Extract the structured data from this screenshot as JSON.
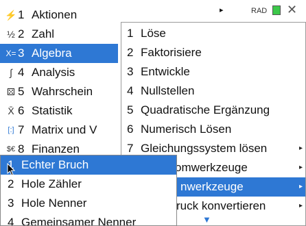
{
  "statusbar": {
    "mode": "RAD",
    "arrow": "▸",
    "battery_color": "#3cc84a"
  },
  "menu1": {
    "items": [
      {
        "num": "1",
        "label": "Aktionen",
        "icon": "lightning-icon",
        "glyph": "⚡"
      },
      {
        "num": "2",
        "label": "Zahl",
        "icon": "fraction-icon",
        "glyph": "½"
      },
      {
        "num": "3",
        "label": "Algebra",
        "icon": "x-equals-icon",
        "glyph": "X="
      },
      {
        "num": "4",
        "label": "Analysis",
        "icon": "integral-icon",
        "glyph": "∫"
      },
      {
        "num": "5",
        "label": "Wahrschein",
        "icon": "dice-icon",
        "glyph": "⚄"
      },
      {
        "num": "6",
        "label": "Statistik",
        "icon": "xbar-icon",
        "glyph": "X̄"
      },
      {
        "num": "7",
        "label": "Matrix und V",
        "icon": "matrix-icon",
        "glyph": "[:]"
      },
      {
        "num": "8",
        "label": "Finanzen",
        "icon": "currency-icon",
        "glyph": "$€"
      }
    ]
  },
  "menu2": {
    "items": [
      {
        "num": "1",
        "label": "Löse"
      },
      {
        "num": "2",
        "label": "Faktorisiere"
      },
      {
        "num": "3",
        "label": "Entwickle"
      },
      {
        "num": "4",
        "label": "Nullstellen"
      },
      {
        "num": "5",
        "label": "Quadratische Ergänzung"
      },
      {
        "num": "6",
        "label": "Numerisch Lösen"
      },
      {
        "num": "7",
        "label": "Gleichungssystem lösen"
      },
      {
        "num": "",
        "label": "omwerkzeuge"
      },
      {
        "num": "",
        "label": "nwerkzeuge"
      },
      {
        "num": "",
        "label": "ruck konvertieren"
      }
    ],
    "submenu_arrow": "▸",
    "scroll_arrow": "▼"
  },
  "menu3": {
    "items": [
      {
        "num": "1",
        "label": "Echter Bruch"
      },
      {
        "num": "2",
        "label": "Hole Zähler"
      },
      {
        "num": "3",
        "label": "Hole Nenner"
      },
      {
        "num": "4",
        "label": "Gemeinsamer Nenner"
      }
    ]
  },
  "colors": {
    "selection": "#2e78d4",
    "accent_arrow": "#2e78d4"
  }
}
